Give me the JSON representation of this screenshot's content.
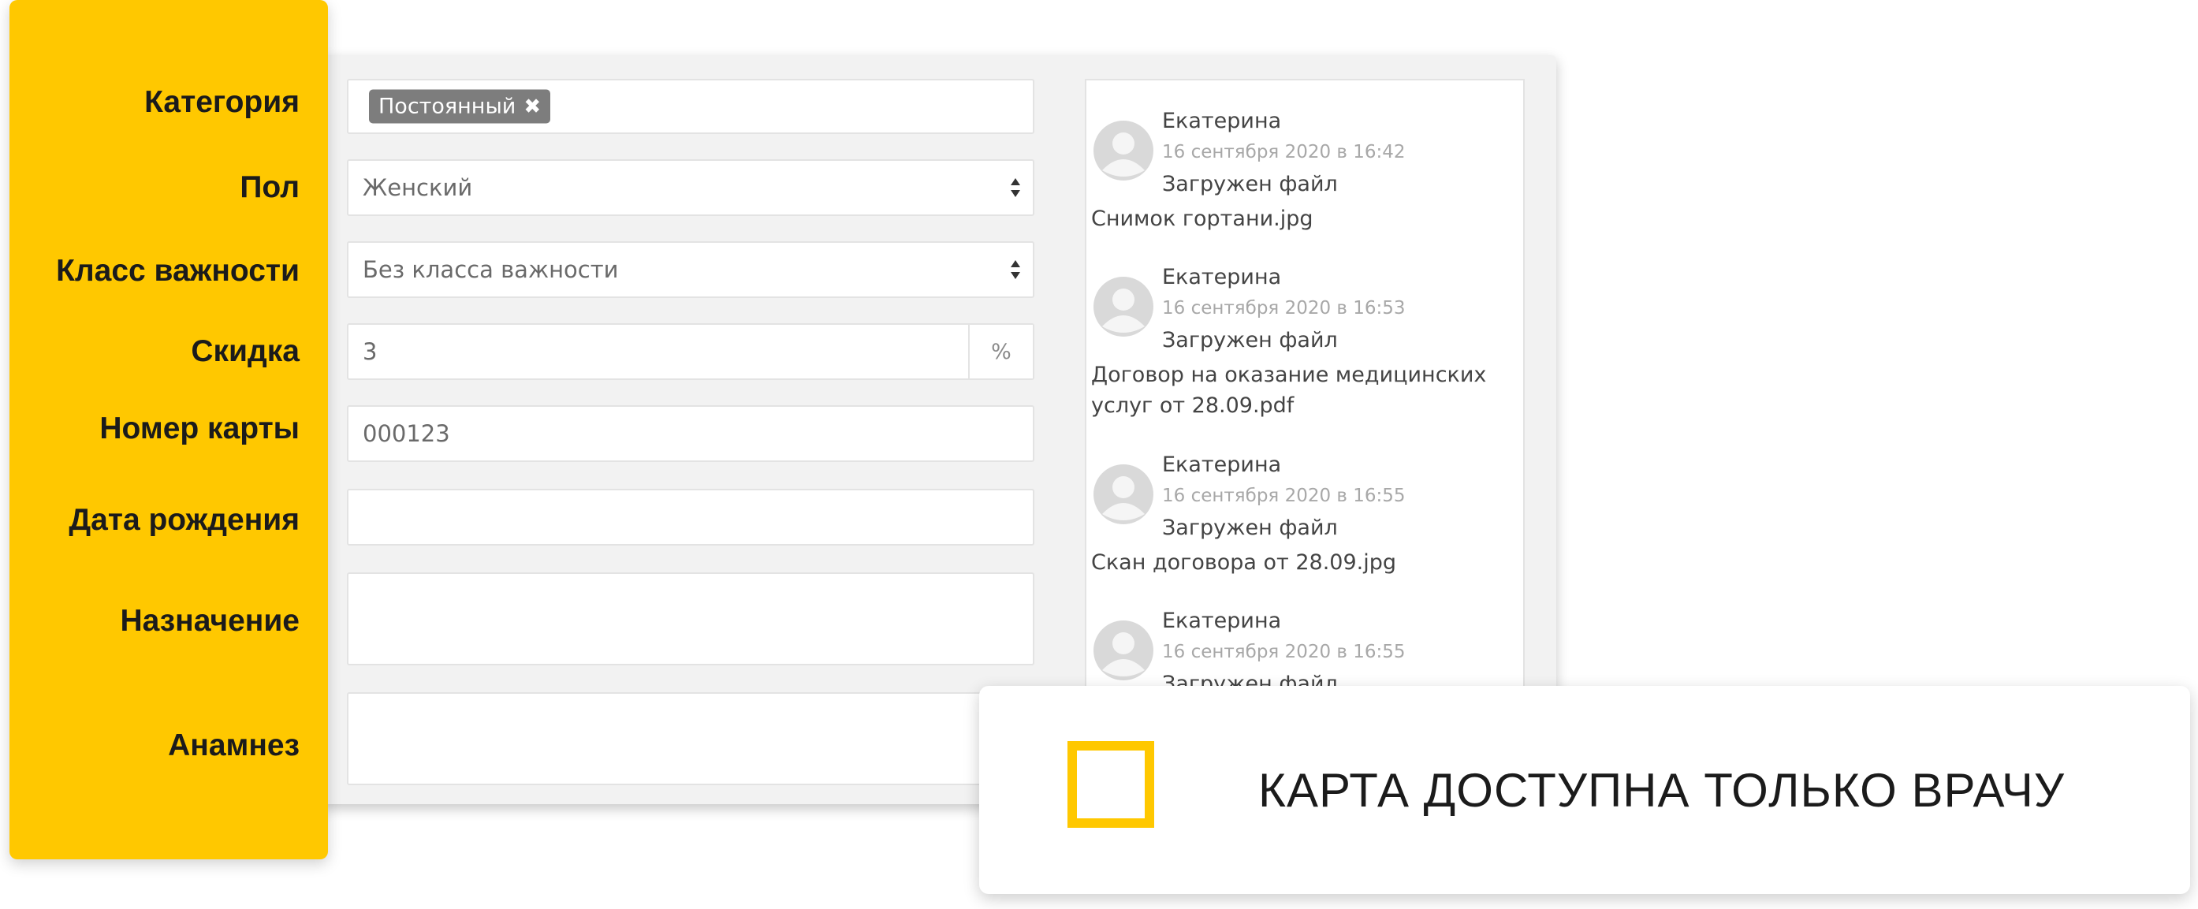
{
  "labels": {
    "category": "Категория",
    "gender": "Пол",
    "importance": "Класс важности",
    "discount": "Скидка",
    "card_number": "Номер карты",
    "birth_date": "Дата рождения",
    "purpose": "Назначение",
    "anamnesis": "Анамнез"
  },
  "form": {
    "category_tag": "Постоянный",
    "category_tag_remove": "✖",
    "gender_value": "Женский",
    "importance_value": "Без класса важности",
    "discount_value": "3",
    "discount_unit": "%",
    "card_number_value": "000123",
    "birth_date_value": "",
    "purpose_value": "",
    "anamnesis_value": ""
  },
  "feed": {
    "entries": [
      {
        "author": "Екатерина",
        "time": "16 сентября 2020 в 16:42",
        "action": "Загружен файл",
        "file": "Снимок гортани.jpg"
      },
      {
        "author": "Екатерина",
        "time": "16 сентября 2020 в 16:53",
        "action": "Загружен файл",
        "file": "Договор на оказание медицинских услуг от 28.09.pdf"
      },
      {
        "author": "Екатерина",
        "time": "16 сентября 2020 в 16:55",
        "action": "Загружен файл",
        "file": "Скан договора от 28.09.jpg"
      },
      {
        "author": "Екатерина",
        "time": "16 сентября 2020 в 16:55",
        "action": "Загружен файл",
        "file": ""
      }
    ]
  },
  "notice": {
    "text": "КАРТА ДОСТУПНА ТОЛЬКО ВРАЧУ",
    "checked": false
  },
  "colors": {
    "accent": "#ffc800",
    "tag": "#7d7d7d",
    "card": "#f2f2f2"
  },
  "icons": {
    "avatar": "user-avatar-icon",
    "select": "sort-arrows-icon",
    "remove": "close-icon"
  }
}
